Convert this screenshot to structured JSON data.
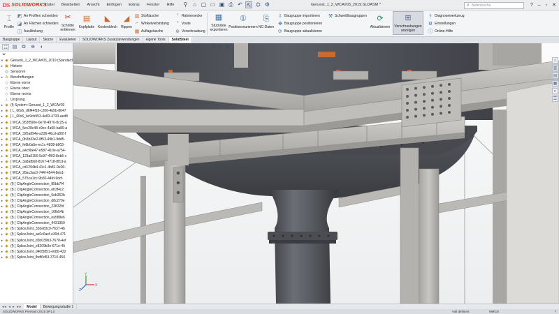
{
  "app": {
    "logo_ds": "DS",
    "logo_text": "SOLIDWORKS",
    "menu": [
      "Datei",
      "Bearbeiten",
      "Ansicht",
      "Einfügen",
      "Extras",
      "Fenster",
      "Hilfe"
    ],
    "document_title": "Geruest_1_2_WCA#03_2019.SLDASM *",
    "search_placeholder": "Befehlsuche"
  },
  "ribbon": {
    "profile": "Profile",
    "profile_cut_1": "An Profilen schneiden",
    "profile_cut_2": "An Flächen schneiden",
    "notch": "Ausklinkung",
    "cuts_remove_1": "Schnitte",
    "cuts_remove_2": "entfernen",
    "head_plate": "Kopfplatte",
    "gusset": "Knotenblech",
    "rib": "Rippen",
    "butt_plate": "Stoßlasche",
    "angle_conn": "Winkelverbindung",
    "support_plate": "Auflagelasche",
    "frame_corner": "Rahmenecke",
    "eave": "Voute",
    "bolting": "Verschraubung",
    "bom_1": "Stückliste",
    "bom_2": "exportieren",
    "item_numbers": "Positionsnummern",
    "nc_data": "NC-Daten",
    "asm_import": "Baugruppe importieren",
    "asm_position": "Baugruppe positionieren",
    "asm_update": "Baugruppe aktualisieren",
    "weld_asm": "Schweißbaugruppen",
    "update": "Aktualisieren",
    "show_bolts_1": "Verschraubungen",
    "show_bolts_2": "anzeigen",
    "diagnose": "Diagnosewerkzeug",
    "settings": "Einstellungen",
    "online_help": "Online-Hilfe"
  },
  "command_tabs": [
    "Baugruppe",
    "Layout",
    "Skizze",
    "Evaluieren",
    "SOLIDWORKS Zusatzanwendungen",
    "eigene Tools",
    "SolidSteel"
  ],
  "active_command_tab": "SolidSteel",
  "tree": {
    "root": "Geruest_1_2_WCA#03_2019  (Standard<",
    "items": [
      {
        "icon": "history",
        "label": "Historie"
      },
      {
        "icon": "sensor",
        "label": "Sensoren"
      },
      {
        "icon": "annotation",
        "label": "Beschriftungen"
      },
      {
        "icon": "plane",
        "label": "Ebene vorne"
      },
      {
        "icon": "plane",
        "label": "Ebene oben"
      },
      {
        "icon": "plane",
        "label": "Ebene rechts"
      },
      {
        "icon": "origin",
        "label": "Ursprung"
      },
      {
        "icon": "part",
        "label": "(f) System~Geruest_1_2_WCA#03"
      },
      {
        "icon": "part",
        "label": "[ L_60x6_d6f44f16-c206-4b5b-8647"
      },
      {
        "icon": "part",
        "label": "[ L_60x6_bc9cb953-4e83-4733-aed8"
      },
      {
        "icon": "part",
        "label": "[ WCA_953f590e-0e78-4970-8c25-a"
      },
      {
        "icon": "part",
        "label": "[ WCA_5ec28c48-c9ec-4a50-ba89-a"
      },
      {
        "icon": "part",
        "label": "[ WCA_326a894e-a336-46cd-a8f2-f"
      },
      {
        "icon": "part",
        "label": "[ WCA_0b3b33e2-8f53-49b1-9dd5-"
      },
      {
        "icon": "part",
        "label": "[ WCA_fe8b0a5e-ec1c-4838-b803-"
      },
      {
        "icon": "part",
        "label": "[ WCA_a4c9be47-e587-410e-a754-"
      },
      {
        "icon": "part",
        "label": "[ WCA_123a5150-5c97-4f03-8eb5-c"
      },
      {
        "icon": "part",
        "label": "[ WCA_3a8afbb0-8167-4718-8f1d-a"
      },
      {
        "icon": "part",
        "label": "[ WCA_cd1294b4-41c1-4b81-9e00-"
      },
      {
        "icon": "part",
        "label": "[ WCA_28ac3ac0-744f-4544-8eb1-"
      },
      {
        "icon": "part",
        "label": "[ WCA_575ca1cc-9b30-44fd-9dcf-"
      },
      {
        "icon": "part",
        "label": "(f) [ ClipAngleConnection_85bb7f4"
      },
      {
        "icon": "part",
        "label": "(f) [ ClipAngleConnection_eb3f4c2"
      },
      {
        "icon": "part",
        "label": "(f) [ ClipAngleConnection_6eb352b"
      },
      {
        "icon": "part",
        "label": "(f) [ ClipAngleConnection_d8c279e"
      },
      {
        "icon": "part",
        "label": "(f) [ ClipAngleConnection_23832fd"
      },
      {
        "icon": "part",
        "label": "(f) [ ClipAngleConnection_16fb54b"
      },
      {
        "icon": "part",
        "label": "(f) [ ClipAngleConnection_ea588e6"
      },
      {
        "icon": "part",
        "label": "(f) [ ClipAngleConnection_4431350"
      },
      {
        "icon": "part",
        "label": "(f) [ SpliceJoint_32de83c9-7637-4b"
      },
      {
        "icon": "part",
        "label": "(f) [ SpliceJoint_ae0c0aef-e30d-471"
      },
      {
        "icon": "part",
        "label": "(f) [ SpliceJoint_d3b039b3-7678-4ef"
      },
      {
        "icon": "part",
        "label": "(f) [ SpliceJoint_e8209b3e-671e-45"
      },
      {
        "icon": "part",
        "label": "(f) [ SpliceJoint_d40f5851-e680-432"
      },
      {
        "icon": "part",
        "label": "(f) [ SpliceJoint_fbdf6d53-3710-450"
      }
    ]
  },
  "bottom_tabs": [
    "Model",
    "Bewegungsstudie 1"
  ],
  "active_bottom_tab": "Model",
  "status": {
    "left": "SOLIDWORKS Premium 2019 SP1.0",
    "definition": "Voll definiert",
    "units": "MMGS",
    "help": "?"
  },
  "triad_axes": {
    "x": "X",
    "y": "Y",
    "z": "Z"
  },
  "icons": {
    "search": "search-icon",
    "new": "new-document-icon",
    "open": "open-folder-icon",
    "save": "save-icon",
    "undo": "undo-icon",
    "select": "select-arrow-icon",
    "pin": "pin-icon"
  },
  "colors": {
    "brand": "#e3312d",
    "selection": "#c6daf0",
    "steel": "#b4b2ae",
    "tank": "#4d4f55",
    "plate": "#c96a2e"
  }
}
